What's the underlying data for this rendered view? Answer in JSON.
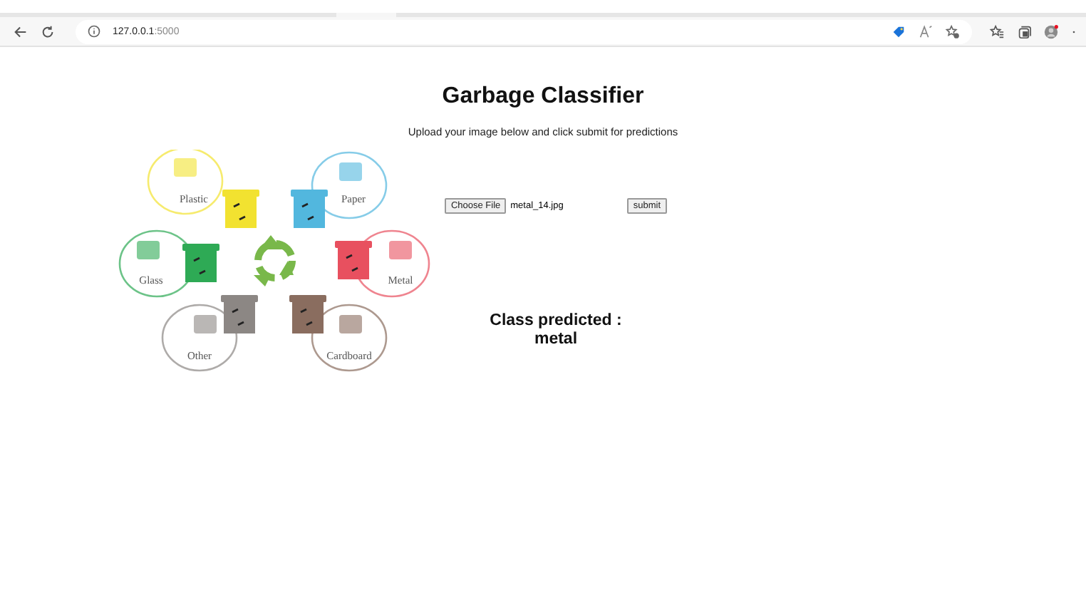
{
  "browser": {
    "url_host": "127.0.0.1",
    "url_port": ":5000"
  },
  "page": {
    "title": "Garbage Classifier",
    "subtitle": "Upload your image below and click submit for predictions",
    "categories": [
      {
        "label": "Plastic",
        "color": "#f2e230"
      },
      {
        "label": "Paper",
        "color": "#52b7de"
      },
      {
        "label": "Glass",
        "color": "#2eaa55"
      },
      {
        "label": "Metal",
        "color": "#e8505f"
      },
      {
        "label": "Other",
        "color": "#8c8784"
      },
      {
        "label": "Cardboard",
        "color": "#8a6d5f"
      }
    ],
    "file_button": "Choose File",
    "file_name": "metal_14.jpg",
    "submit": "submit",
    "result_label": "Class predicted :",
    "result_value": "metal"
  }
}
